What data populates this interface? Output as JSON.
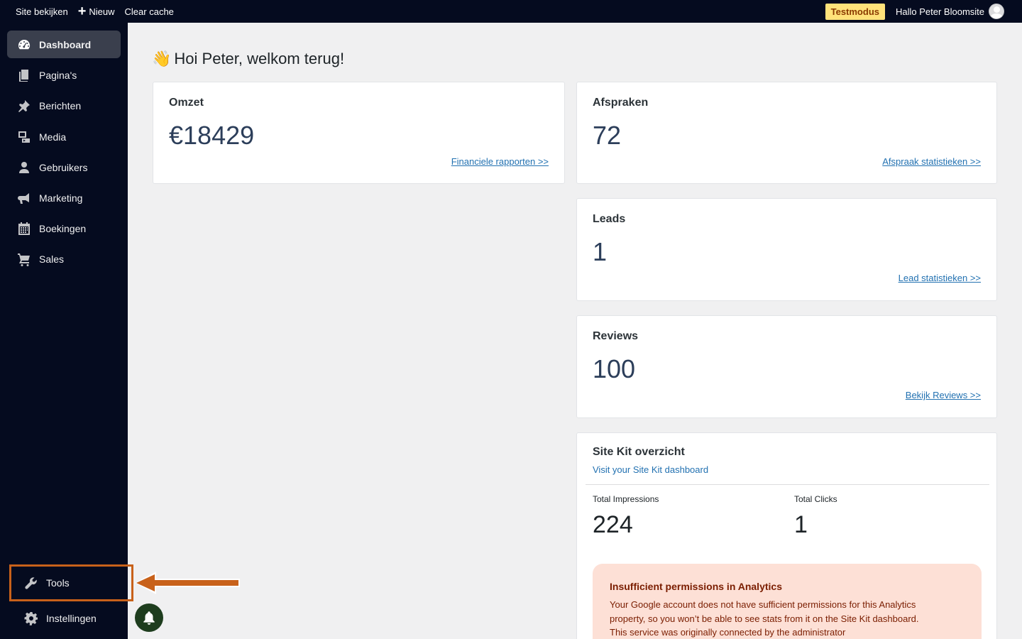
{
  "adminbar": {
    "view_site": "Site bekijken",
    "new_label": "Nieuw",
    "clear_cache": "Clear cache",
    "test_mode": "Testmodus",
    "greeting_user": "Hallo Peter Bloomsite"
  },
  "sidebar": {
    "items": [
      {
        "label": "Dashboard",
        "icon": "dashboard-icon",
        "active": true
      },
      {
        "label": "Pagina's",
        "icon": "pages-icon"
      },
      {
        "label": "Berichten",
        "icon": "pin-icon"
      },
      {
        "label": "Media",
        "icon": "media-icon"
      },
      {
        "label": "Gebruikers",
        "icon": "user-icon"
      },
      {
        "label": "Marketing",
        "icon": "megaphone-icon"
      },
      {
        "label": "Boekingen",
        "icon": "calendar-icon"
      },
      {
        "label": "Sales",
        "icon": "cart-icon"
      }
    ],
    "bottom_items": [
      {
        "label": "Tools",
        "icon": "wrench-icon"
      },
      {
        "label": "Instellingen",
        "icon": "gear-icon"
      }
    ]
  },
  "main": {
    "wave": "👋",
    "greeting": "Hoi Peter, welkom terug!",
    "cards": {
      "omzet": {
        "title": "Omzet",
        "value": "€18429",
        "link": "Financiele rapporten >>"
      },
      "afspraken": {
        "title": "Afspraken",
        "value": "72",
        "link": "Afspraak statistieken >>"
      },
      "leads": {
        "title": "Leads",
        "value": "1",
        "link": "Lead statistieken >>"
      },
      "reviews": {
        "title": "Reviews",
        "value": "100",
        "link": "Bekijk Reviews >>"
      }
    },
    "sitekit": {
      "title": "Site Kit overzicht",
      "link": "Visit your Site Kit dashboard",
      "impressions_label": "Total Impressions",
      "impressions_value": "224",
      "clicks_label": "Total Clicks",
      "clicks_value": "1",
      "alert_title": "Insufficient permissions in Analytics",
      "alert_line1": "Your Google account does not have sufficient permissions for this Analytics",
      "alert_line2": "property, so you won’t be able to see stats from it on the Site Kit dashboard.",
      "alert_line3": "This service was originally connected by the administrator"
    }
  },
  "colors": {
    "sidebar_bg": "#050b1f",
    "highlight": "#c8611a",
    "link": "#2271b1",
    "testmode_bg": "#ffe27a"
  }
}
